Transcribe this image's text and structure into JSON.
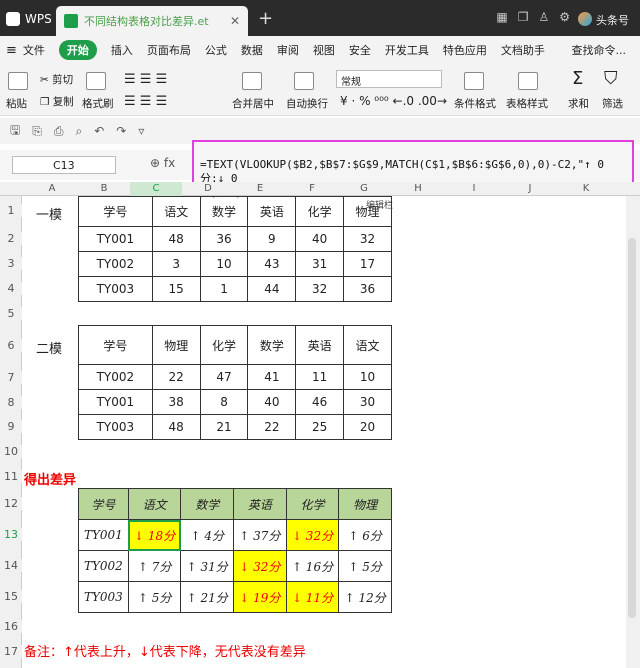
{
  "titlebar": {
    "app": "WPS",
    "file_tab": "不同结构表格对比差异.et",
    "user": "头条号"
  },
  "menu": {
    "file": "文件",
    "items": [
      "开始",
      "插入",
      "页面布局",
      "公式",
      "数据",
      "审阅",
      "视图",
      "安全",
      "开发工具",
      "特色应用",
      "文档助手"
    ],
    "search": "查找命令..."
  },
  "ribbon": {
    "paste": "粘贴",
    "cut": "剪切",
    "copy": "复制",
    "format_painter": "格式刷",
    "merge_center": "合并居中",
    "wrap_text": "自动换行",
    "number_format": "常规",
    "cond_format": "条件格式",
    "table_style": "表格样式",
    "sum": "求和",
    "filter": "筛选"
  },
  "formula_bar": {
    "cell_ref": "C13",
    "formula_line1": "=TEXT(VLOOKUP($B2,$B$7:$G$9,MATCH(C$1,$B$6:$G$6,0),0)-C2,\"↑ 0分;↓ 0",
    "formula_line2": "分;无\")",
    "edit_tip": "编辑栏"
  },
  "columns": [
    "A",
    "B",
    "C",
    "D",
    "E",
    "F",
    "G",
    "H",
    "I",
    "J",
    "K"
  ],
  "rows": [
    "1",
    "2",
    "3",
    "4",
    "5",
    "6",
    "7",
    "8",
    "9",
    "10",
    "11",
    "12",
    "13",
    "14",
    "15",
    "16",
    "17"
  ],
  "table1": {
    "label": "一模",
    "header": [
      "学号",
      "语文",
      "数学",
      "英语",
      "化学",
      "物理"
    ],
    "rows": [
      [
        "TY001",
        "48",
        "36",
        "9",
        "40",
        "32"
      ],
      [
        "TY002",
        "3",
        "10",
        "43",
        "31",
        "17"
      ],
      [
        "TY003",
        "15",
        "1",
        "44",
        "32",
        "36"
      ]
    ]
  },
  "table2": {
    "label": "二模",
    "header": [
      "学号",
      "物理",
      "化学",
      "数学",
      "英语",
      "语文"
    ],
    "rows": [
      [
        "TY002",
        "22",
        "47",
        "41",
        "11",
        "10"
      ],
      [
        "TY001",
        "38",
        "8",
        "40",
        "46",
        "30"
      ],
      [
        "TY003",
        "48",
        "21",
        "22",
        "25",
        "20"
      ]
    ]
  },
  "table3": {
    "label": "得出差异",
    "header": [
      "学号",
      "语文",
      "数学",
      "英语",
      "化学",
      "物理"
    ],
    "rows": [
      [
        "TY001",
        "↓ 18分",
        "↑ 4分",
        "↑ 37分",
        "↓ 32分",
        "↑ 6分"
      ],
      [
        "TY002",
        "↑ 7分",
        "↑ 31分",
        "↓ 32分",
        "↑ 16分",
        "↑ 5分"
      ],
      [
        "TY003",
        "↑ 5分",
        "↑ 21分",
        "↓ 19分",
        "↓ 11分",
        "↑ 12分"
      ]
    ]
  },
  "note": "备注：↑代表上升，↓代表下降，无代表没有差异",
  "colors": {
    "accent": "#1e9e4a",
    "highlight": "#ffff00",
    "header_fill": "#b8d59a",
    "red_text": "#e00000",
    "formula_border": "#e040e0"
  }
}
